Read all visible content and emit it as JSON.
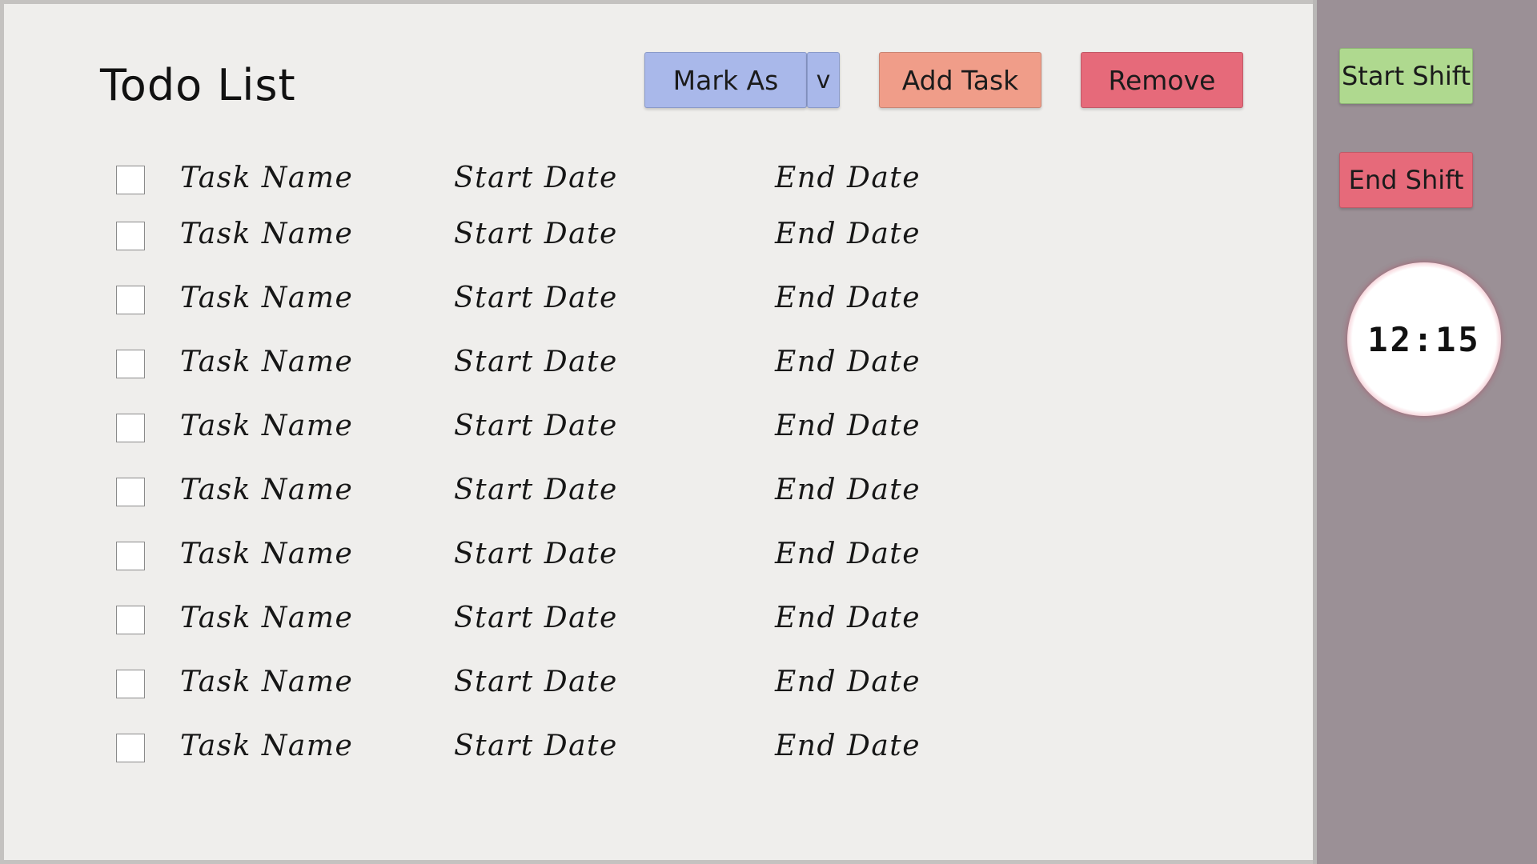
{
  "header": {
    "title": "Todo List"
  },
  "toolbar": {
    "mark_as_label": "Mark As",
    "mark_as_dropdown_label": "v",
    "add_task_label": "Add Task",
    "remove_label": "Remove"
  },
  "sidebar": {
    "start_shift_label": "Start Shift",
    "end_shift_label": "End Shift",
    "clock_time": "12:15"
  },
  "tasks": [
    {
      "name": "Task Name",
      "start": "Start Date",
      "end": "End Date",
      "checked": false
    },
    {
      "name": "Task Name",
      "start": "Start Date",
      "end": "End Date",
      "checked": false
    },
    {
      "name": "Task Name",
      "start": "Start Date",
      "end": "End Date",
      "checked": false
    },
    {
      "name": "Task Name",
      "start": "Start Date",
      "end": "End Date",
      "checked": false
    },
    {
      "name": "Task Name",
      "start": "Start Date",
      "end": "End Date",
      "checked": false
    },
    {
      "name": "Task Name",
      "start": "Start Date",
      "end": "End Date",
      "checked": false
    },
    {
      "name": "Task Name",
      "start": "Start Date",
      "end": "End Date",
      "checked": false
    },
    {
      "name": "Task Name",
      "start": "Start Date",
      "end": "End Date",
      "checked": false
    },
    {
      "name": "Task Name",
      "start": "Start Date",
      "end": "End Date",
      "checked": false
    },
    {
      "name": "Task Name",
      "start": "Start Date",
      "end": "End Date",
      "checked": false
    }
  ],
  "colors": {
    "main_bg": "#efeeec",
    "sidebar_bg": "#9b9096",
    "mark_as": "#a9b8ea",
    "add_task": "#f09d89",
    "remove": "#e66a7a",
    "start_shift": "#afd98f",
    "end_shift": "#e66a7a",
    "clock_ring": "#dc4060"
  }
}
